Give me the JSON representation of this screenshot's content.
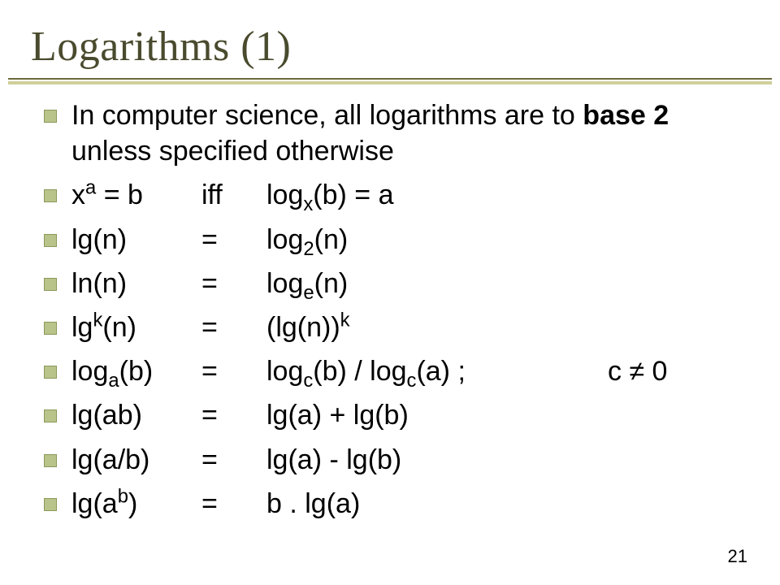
{
  "title": "Logarithms (1)",
  "page_number": "21",
  "bullets": {
    "b0_pre": "In computer science, all logarithms are to ",
    "b0_bold": "base 2",
    "b0_post": " unless specified otherwise",
    "b1_c1a": "x",
    "b1_c1b": "a",
    "b1_c1c": " = b",
    "b1_c2": "iff",
    "b1_c3a": "log",
    "b1_c3b": "x",
    "b1_c3c": "(b) = a",
    "b2_c1": "lg(n)",
    "b2_c2": "=",
    "b2_c3a": "log",
    "b2_c3b": "2",
    "b2_c3c": "(n)",
    "b3_c1": "ln(n)",
    "b3_c2": "=",
    "b3_c3a": "log",
    "b3_c3b": "e",
    "b3_c3c": "(n)",
    "b4_c1a": "lg",
    "b4_c1b": "k",
    "b4_c1c": "(n)",
    "b4_c2": "=",
    "b4_c3a": "(lg(n))",
    "b4_c3b": "k",
    "b5_c1a": "log",
    "b5_c1b": "a",
    "b5_c1c": "(b)",
    "b5_c2": "=",
    "b5_c3a": "log",
    "b5_c3b": "c",
    "b5_c3c": "(b) / log",
    "b5_c3d": "c",
    "b5_c3e": "(a) ;",
    "b5_cond": "c ≠ 0",
    "b6_c1": "lg(ab)",
    "b6_c2": "=",
    "b6_c3": "lg(a) + lg(b)",
    "b7_c1": "lg(a/b)",
    "b7_c2": "=",
    "b7_c3": "lg(a) - lg(b)",
    "b8_c1a": "lg(a",
    "b8_c1b": "b",
    "b8_c1c": ")",
    "b8_c2": "=",
    "b8_c3": "b . lg(a)"
  }
}
